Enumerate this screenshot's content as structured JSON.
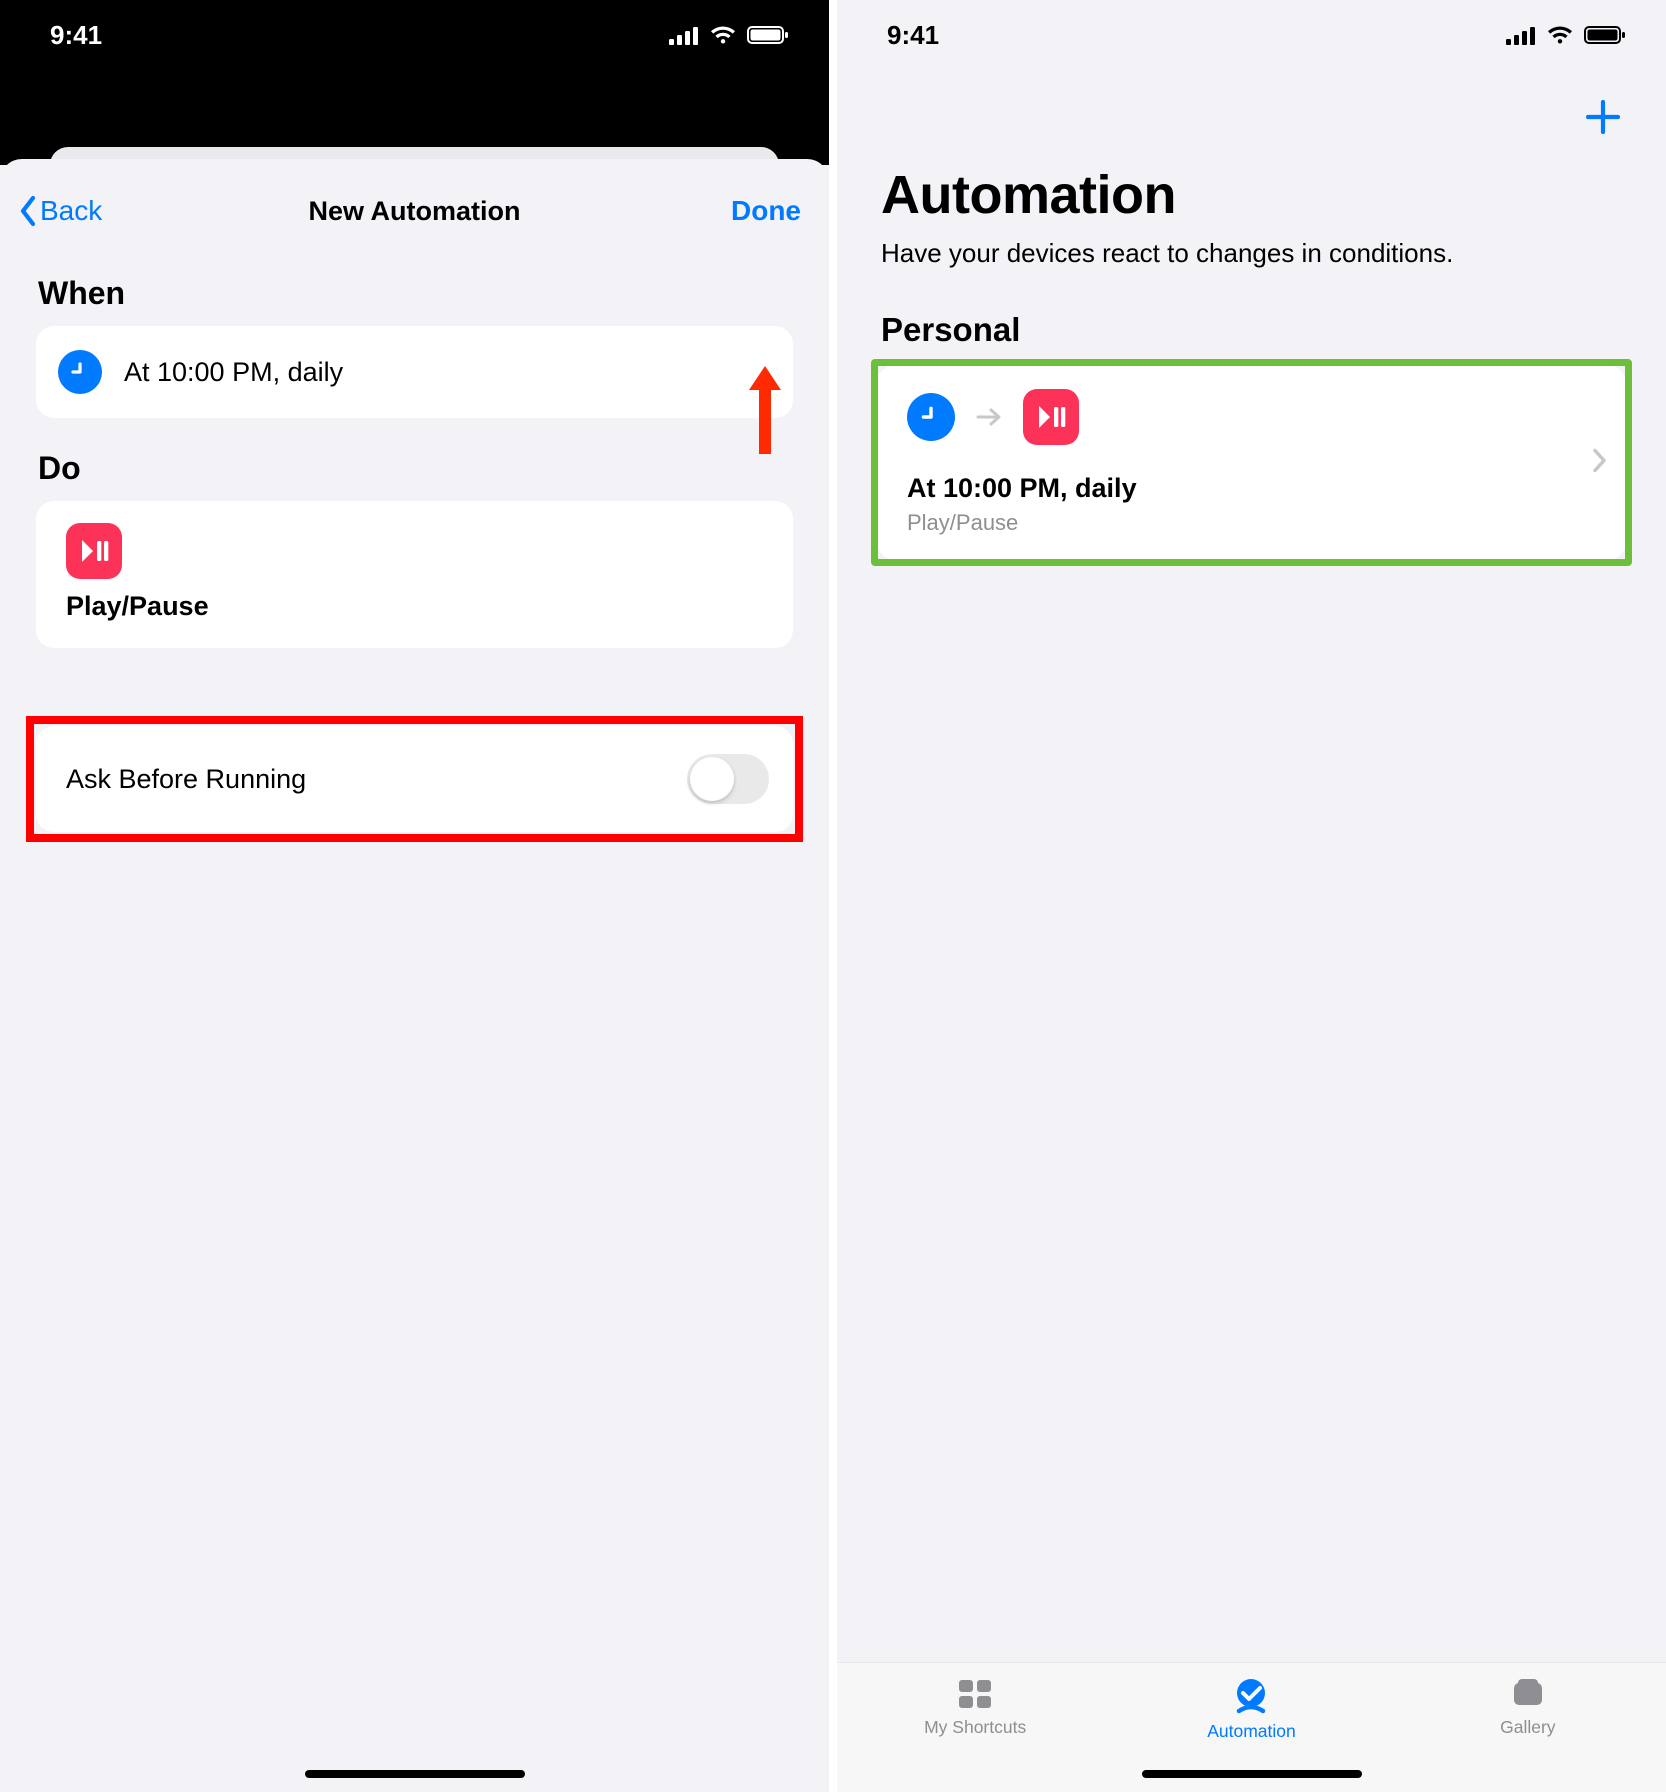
{
  "status": {
    "time": "9:41"
  },
  "left": {
    "nav": {
      "back": "Back",
      "title": "New Automation",
      "done": "Done"
    },
    "sections": {
      "when_label": "When",
      "when_text": "At 10:00 PM, daily",
      "do_label": "Do",
      "do_action": "Play/Pause"
    },
    "ask": {
      "label": "Ask Before Running",
      "value": false
    },
    "annotations": {
      "done_arrow": true,
      "ask_highlight": true
    }
  },
  "right": {
    "title": "Automation",
    "subtitle": "Have your devices react to changes in conditions.",
    "section": "Personal",
    "card": {
      "title": "At 10:00 PM, daily",
      "subtitle": "Play/Pause"
    },
    "tabs": {
      "shortcuts": "My Shortcuts",
      "automation": "Automation",
      "gallery": "Gallery",
      "active": "automation"
    },
    "annotations": {
      "card_highlight": true
    }
  },
  "colors": {
    "ios_blue": "#007aff",
    "ios_red": "#fc3259",
    "annot_red": "#ff0000",
    "annot_green": "#6bbf3a",
    "gray_text": "#8e8e93"
  }
}
